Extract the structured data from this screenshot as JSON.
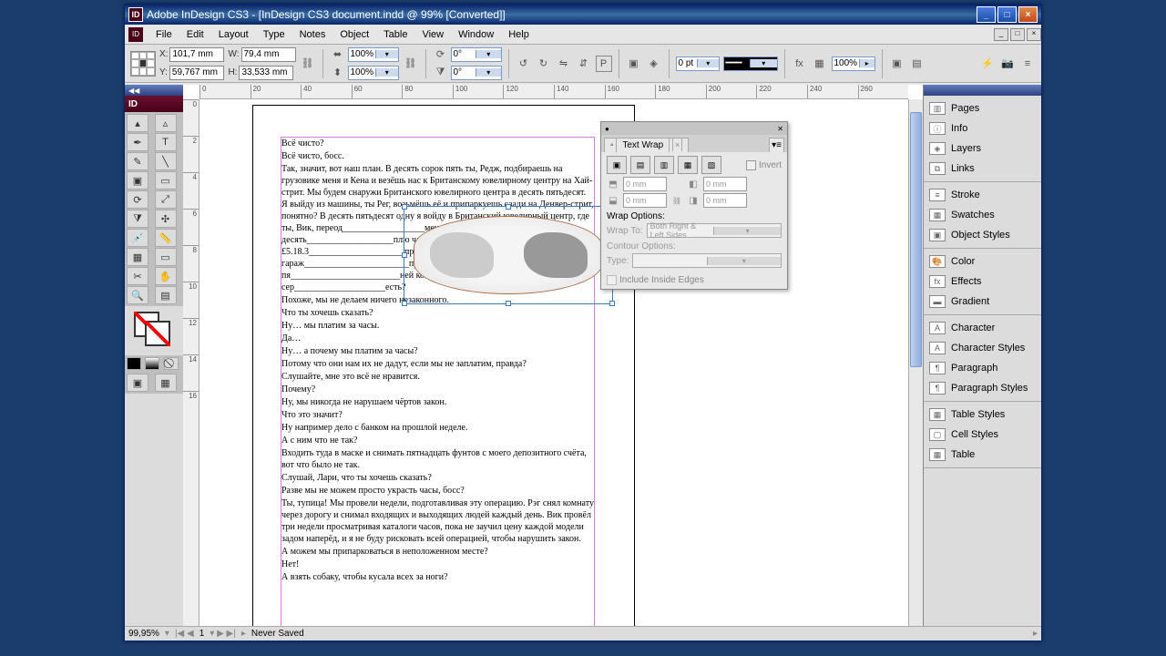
{
  "app": {
    "title_prefix": "Adobe InDesign CS3 - ",
    "document": "[InDesign CS3 document.indd @ 99% [Converted]]",
    "icon_label": "ID"
  },
  "menu": [
    "File",
    "Edit",
    "Layout",
    "Type",
    "Notes",
    "Object",
    "Table",
    "View",
    "Window",
    "Help"
  ],
  "controls": {
    "x": "101,7 mm",
    "y": "59,767 mm",
    "w": "79,4 mm",
    "h": "33,533 mm",
    "scale_x": "100%",
    "scale_y": "100%",
    "rotate": "0°",
    "shear": "0°",
    "stroke": "0 pt",
    "opacity": "100%"
  },
  "ruler_h": [
    "0",
    "20",
    "40",
    "60",
    "80",
    "100",
    "120",
    "140",
    "160",
    "180",
    "200",
    "220",
    "240",
    "260"
  ],
  "ruler_v": [
    "0",
    "2",
    "4",
    "6",
    "8",
    "10",
    "12",
    "14",
    "16"
  ],
  "document_text": [
    "Всё чисто?",
    "Всё чисто, босс.",
    "Так, значит, вот наш план. В десять сорок пять ты, Редж, подбираешь на грузовике меня и Кена и везёшь нас к Британскому ювелирному центру на Хай-стрит. Мы будем снаружи Британского ювелирного центра в десять пятьдесят. Я выйду из машины, ты Рег, возьмёшь её и припаркуешь сзади на Денвер-стрит, понятно? В десять пятьдесят одну я войду в Британский ювелирный центр, где ты, Вик, переод__________________меня и передашь мне £5.18.3d. В десять___________________плю часы стоимостью £5.18.3_____________________правишься прямиком в гараж_______________________прикрывать нас до десяти пя________________________ней комнате бара «корова с сер____________________есть?",
    "Похоже, мы не делаем ничего незаконного.",
    "Что ты хочешь сказать?",
    "Ну… мы платим за часы.",
    "Да…",
    "Ну… а почему мы платим за часы?",
    "Потому что они нам их не дадут, если мы не заплатим, правда?",
    "Слушайте, мне это всё не нравится.",
    "Почему?",
    "Ну, мы никогда не нарушаем чёртов закон.",
    "Что это значит?",
    "Ну например дело с банком на прошлой неделе.",
    "А с ним что не так?",
    "Входить туда в маске и снимать пятнадцать фунтов с моего депозитного счёта, вот что было не так.",
    "Слушай, Лари, что ты хочешь сказать?",
    "Разве мы не можем просто украсть часы, босс?",
    "Ты, тупица! Мы провели недели, подготавливая эту операцию. Рэг снял комнату через дорогу и снимал входящих и выходящих людей каждый день. Вик провёл три недели просматривая каталоги часов, пока не заучил цену каждой модели задом наперёд, и я не буду рисковать всей операцией, чтобы нарушить закон.",
    "А можем мы припарковаться в неположенном месте?",
    "Нет!",
    "А взять собаку, чтобы кусала всех за ноги?"
  ],
  "textwrap": {
    "title": "Text Wrap",
    "invert": "Invert",
    "offset_top": "0 mm",
    "offset_bottom": "0 mm",
    "offset_left": "0 mm",
    "offset_right": "0 mm",
    "options_label": "Wrap Options:",
    "wrap_to_label": "Wrap To:",
    "wrap_to": "Both Right & Left Sides",
    "contour_label": "Contour Options:",
    "type_label": "Type:",
    "include_edges": "Include Inside Edges"
  },
  "panels": {
    "group1": [
      "Pages",
      "Info",
      "Layers",
      "Links"
    ],
    "group2": [
      "Stroke",
      "Swatches",
      "Object Styles"
    ],
    "group3": [
      "Color",
      "Effects",
      "Gradient"
    ],
    "group4": [
      "Character",
      "Character Styles",
      "Paragraph",
      "Paragraph Styles"
    ],
    "group5": [
      "Table Styles",
      "Cell Styles",
      "Table"
    ]
  },
  "status": {
    "zoom": "99,95%",
    "page": "1",
    "save": "Never Saved"
  }
}
